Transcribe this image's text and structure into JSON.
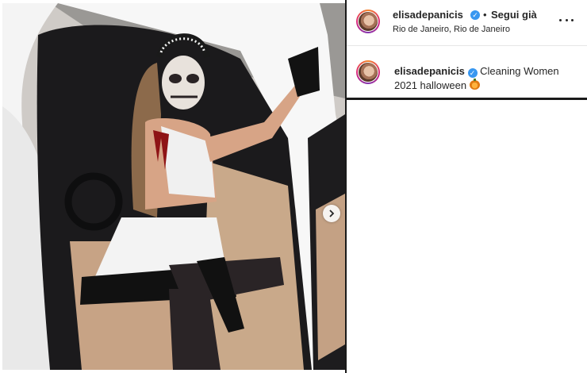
{
  "post": {
    "header": {
      "username": "elisadepanicis",
      "separator": "•",
      "follow_label": "Segui già",
      "location": "Rio de Janeiro, Rio de Janeiro"
    },
    "caption": {
      "username": "elisadepanicis",
      "text": "Cleaning Women 2021 halloween",
      "emoji": "pumpkin"
    },
    "more_icon": "more-horizontal-icon",
    "verified_icon": "verified-badge-icon",
    "carousel_icon": "chevron-right-icon"
  },
  "colors": {
    "verified": "#3897f0",
    "text": "#262626",
    "divider": "#1a1a1a"
  }
}
